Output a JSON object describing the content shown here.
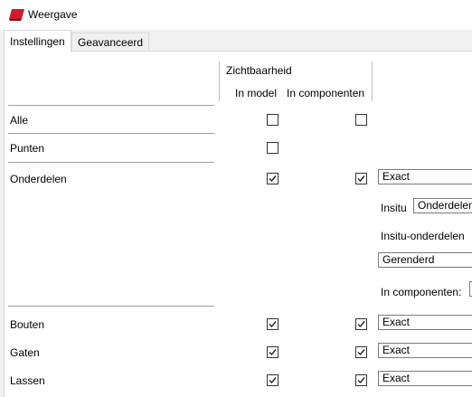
{
  "window": {
    "title": "Weergave",
    "accent": "#cc1f2b"
  },
  "tabs": [
    "Instellingen",
    "Geavanceerd"
  ],
  "header": {
    "group": "Zichtbaarheid",
    "col_model": "In model",
    "col_components": "In componenten"
  },
  "rows": {
    "alle": {
      "label": "Alle",
      "in_model": false,
      "in_components": false
    },
    "punten": {
      "label": "Punten",
      "in_model": false
    },
    "onderdelen": {
      "label": "Onderdelen",
      "in_model": true,
      "in_components": true,
      "mode": "Exact"
    },
    "bouten": {
      "label": "Bouten",
      "in_model": true,
      "in_components": true,
      "mode": "Exact"
    },
    "gaten": {
      "label": "Gaten",
      "in_model": true,
      "in_components": true,
      "mode": "Exact"
    },
    "lassen": {
      "label": "Lassen",
      "in_model": true,
      "in_components": true,
      "mode": "Exact"
    }
  },
  "insitu": {
    "label": "Insitu",
    "value": "Onderdelen",
    "sub_label": "Insitu-onderdelen",
    "sub_value": "Gerenderd",
    "components_label": "In componenten:"
  }
}
